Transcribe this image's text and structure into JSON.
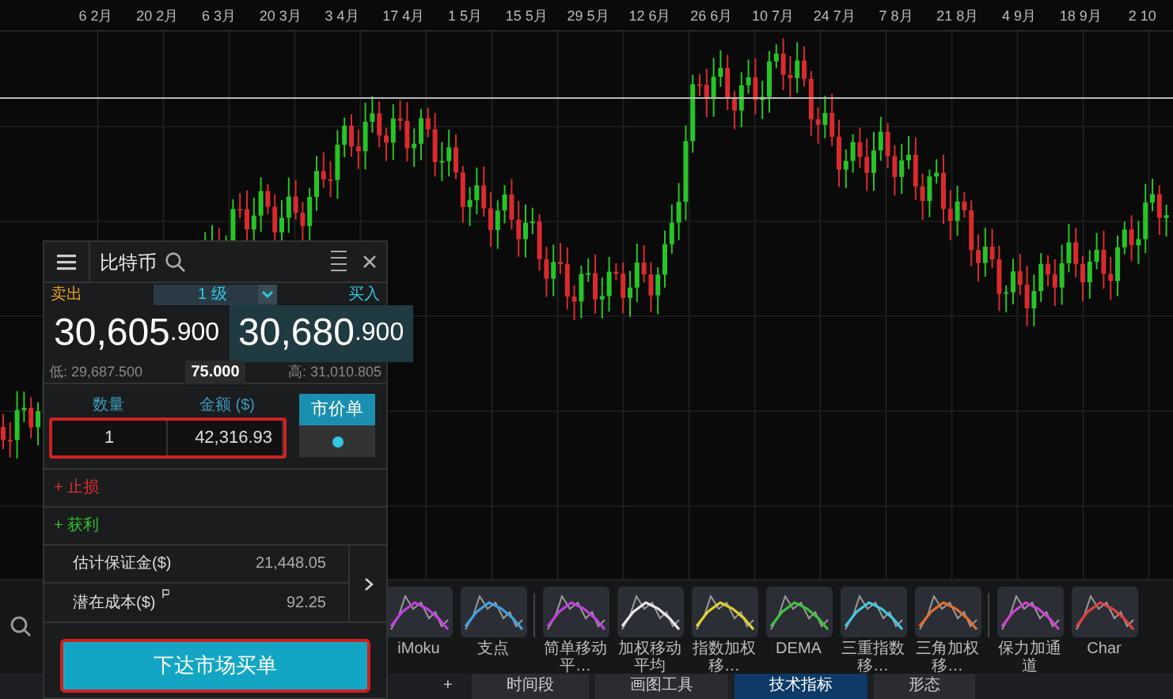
{
  "time_axis": {
    "labels": [
      "6 2月",
      "20 2月",
      "6 3月",
      "20 3月",
      "3 4月",
      "17 4月",
      "1 5月",
      "15 5月",
      "29 5月",
      "12 6月",
      "26 6月",
      "10 7月",
      "24 7月",
      "7 8月",
      "21 8月",
      "4 9月",
      "18 9月",
      "2 10"
    ]
  },
  "trade_panel": {
    "title": "比特币",
    "sell_label": "卖出",
    "buy_label": "买入",
    "level_select": "1 级",
    "sell_price": {
      "main": "30,605",
      "fraction": ".900"
    },
    "buy_price": {
      "main": "30,680",
      "fraction": ".900"
    },
    "low": "低: 29,687.500",
    "spread": "75.000",
    "high": "高: 31,010.805",
    "quantity_label": "数量",
    "amount_label": "金额 ($)",
    "quantity": "1",
    "amount": "42,316.93",
    "order_type": "市价单",
    "order_toggle_on": true,
    "stop_loss": "+ 止损",
    "take_profit": "+ 获利",
    "summary": [
      {
        "label": "估计保证金($)",
        "value": "21,448.05",
        "info": false
      },
      {
        "label": "潜在成本($)",
        "value": "92.25",
        "info": true
      }
    ],
    "submit": "下达市场买单"
  },
  "indicator_groups": [
    [
      {
        "label": "iMoku",
        "color": "#c040e0"
      },
      {
        "label": "支点",
        "color": "#40a0e0"
      }
    ],
    [
      {
        "label": "简单移动平…",
        "color": "#c040e0"
      },
      {
        "label": "加权移动平均",
        "color": "#e8e8e8"
      },
      {
        "label": "指数加权移…",
        "color": "#e0d030"
      },
      {
        "label": "DEMA",
        "color": "#40c040"
      },
      {
        "label": "三重指数移…",
        "color": "#40c8e0"
      },
      {
        "label": "三角加权移…",
        "color": "#e07030"
      }
    ],
    [
      {
        "label": "保力加通道",
        "color": "#d040d0"
      },
      {
        "label": "Char",
        "color": "#e04040"
      }
    ]
  ],
  "bottom_bar": {
    "add_button": "+",
    "tabs": [
      {
        "label": "时间段",
        "selected": false
      },
      {
        "label": "画图工具",
        "selected": false
      },
      {
        "label": "技术指标",
        "selected": true
      },
      {
        "label": "形态",
        "selected": false
      }
    ]
  }
}
